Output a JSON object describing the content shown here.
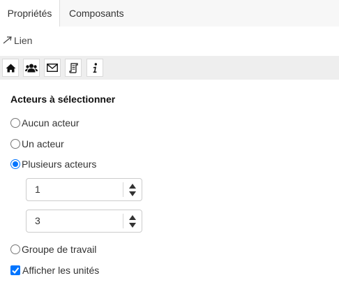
{
  "tabs": [
    {
      "label": "Propriétés",
      "active": true
    },
    {
      "label": "Composants",
      "active": false
    }
  ],
  "link": {
    "icon": "diagonal-arrow-icon",
    "label": "Lien"
  },
  "toolbar": {
    "buttons": [
      {
        "icon": "home-icon"
      },
      {
        "icon": "users-icon"
      },
      {
        "icon": "envelope-icon"
      },
      {
        "icon": "scroll-icon"
      },
      {
        "icon": "info-icon"
      }
    ]
  },
  "actors": {
    "title": "Acteurs à sélectionner",
    "options": [
      {
        "label": "Aucun acteur",
        "checked": false
      },
      {
        "label": "Un acteur",
        "checked": false
      },
      {
        "label": "Plusieurs acteurs",
        "checked": true
      },
      {
        "label": "Groupe de travail",
        "checked": false
      }
    ],
    "min_value": "1",
    "max_value": "3",
    "show_units": {
      "label": "Afficher les unités",
      "checked": true
    }
  },
  "colors": {
    "accent": "#0075ff",
    "toolbar_bg": "#eeeeee",
    "tabs_bg": "#f7f7f7"
  }
}
